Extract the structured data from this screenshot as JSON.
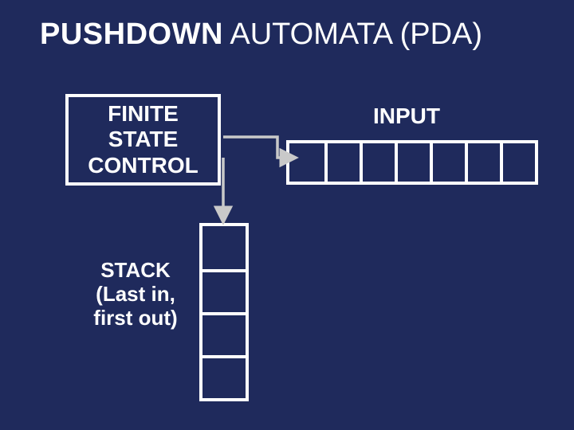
{
  "title": {
    "strong": "PUSHDOWN",
    "rest": " AUTOMATA (PDA)"
  },
  "fsc": "FINITE\nSTATE\nCONTROL",
  "input_label": "INPUT",
  "stack_label": "STACK\n(Last in,\nfirst out)",
  "tape_cells": 7,
  "stack_cells": 4,
  "colors": {
    "bg": "#1f2a5c",
    "fg": "#ffffff",
    "arrow": "#c9c9c9"
  }
}
